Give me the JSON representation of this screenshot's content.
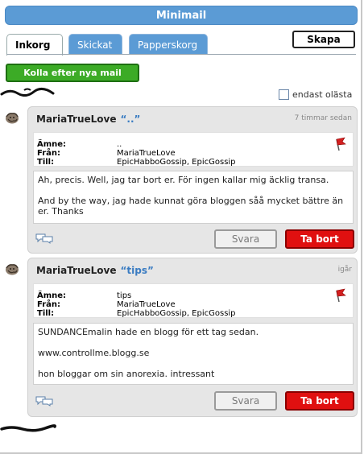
{
  "window": {
    "title": "Minimail"
  },
  "tabs": [
    {
      "label": "Inkorg",
      "active": true
    },
    {
      "label": "Skickat",
      "active": false
    },
    {
      "label": "Papperskorg",
      "active": false
    }
  ],
  "toolbar": {
    "create_label": "Skapa",
    "check_mail_label": "Kolla efter nya mail",
    "unread_only_label": "endast olästa",
    "unread_only_checked": false
  },
  "meta_labels": {
    "subject": "Ämne:",
    "from": "Från:",
    "to": "Till:"
  },
  "actions": {
    "reply_label": "Svara",
    "delete_label": "Ta bort"
  },
  "messages": [
    {
      "sender": "MariaTrueLove",
      "subject_quoted": "“..”",
      "time": "7 timmar sedan",
      "subject": "..",
      "from": "MariaTrueLove",
      "to": "EpicHabboGossip, EpicGossip",
      "body": [
        "Ah, precis. Well, jag tar bort er. För ingen kallar mig äcklig transa.",
        "And by the way, jag hade kunnat göra bloggen såå mycket bättre än er. Thanks"
      ]
    },
    {
      "sender": "MariaTrueLove",
      "subject_quoted": "“tips”",
      "time": "igår",
      "subject": "tips",
      "from": "MariaTrueLove",
      "to": "EpicHabboGossip, EpicGossip",
      "body": [
        "SUNDANCEmalin hade en blogg för ett tag sedan.",
        "www.controllme.blogg.se",
        "hon bloggar om sin anorexia. intressant"
      ]
    }
  ],
  "colors": {
    "title_bar": "#5b9bd5",
    "check_button": "#3cab26",
    "delete_button": "#e01010",
    "subject_accent": "#3a7cc2"
  }
}
